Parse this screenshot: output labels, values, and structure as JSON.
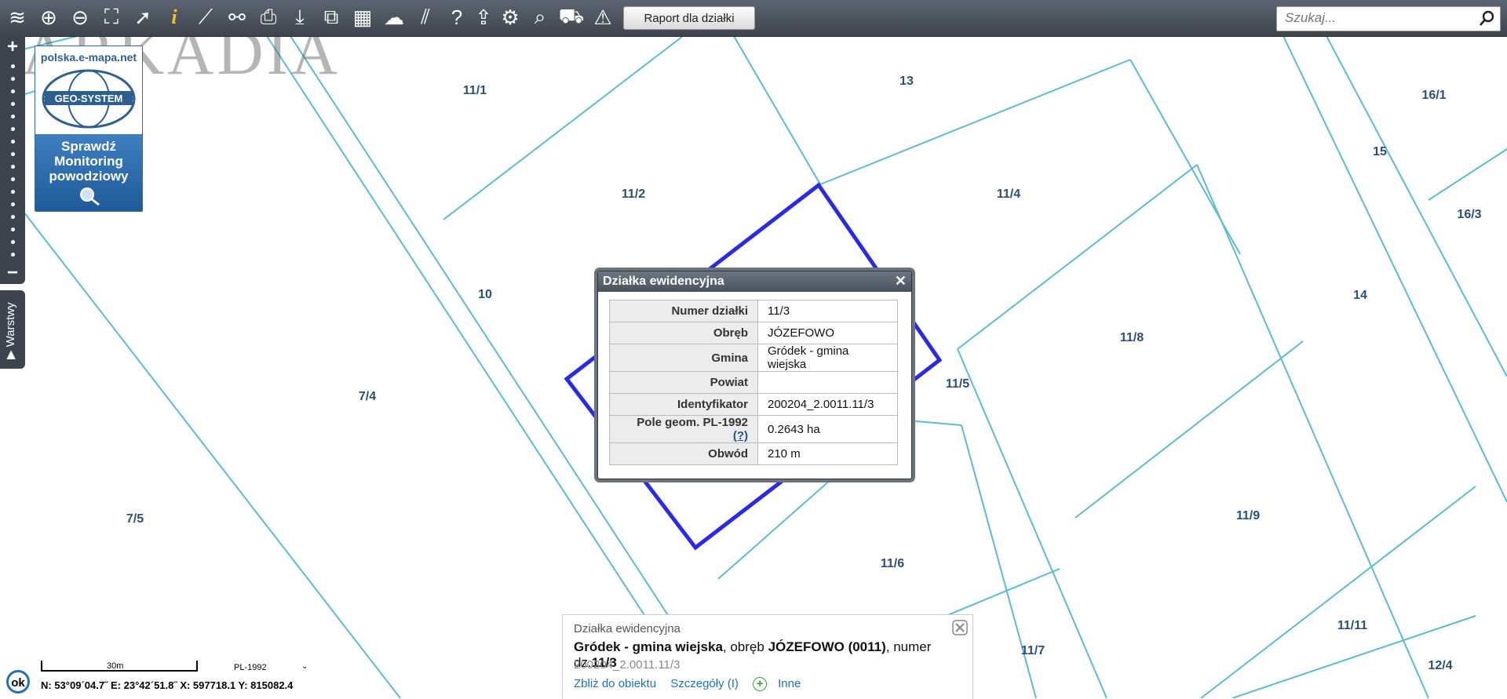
{
  "toolbar": {
    "report_button": "Raport dla działki",
    "search_placeholder": "Szukaj..."
  },
  "watermark": "ARKADIA",
  "promo": {
    "site": "polska.e-mapa.net",
    "logo": "GEO-SYSTEM",
    "text_line1": "Sprawdź",
    "text_line2": "Monitoring",
    "text_line3": "powodziowy"
  },
  "layers_tab": "Warstwy",
  "map": {
    "parcels": [
      "11/1",
      "13",
      "16/1",
      "15",
      "11/2",
      "11/4",
      "16/3",
      "10",
      "14",
      "11/8",
      "7/4",
      "11/5",
      "7/5",
      "11/9",
      "11/6",
      "11/11",
      "11/7",
      "12/4"
    ]
  },
  "popup": {
    "title": "Działka ewidencyjna",
    "rows": [
      {
        "key": "Numer działki",
        "value": "11/3"
      },
      {
        "key": "Obręb",
        "value": "JÓZEFOWO"
      },
      {
        "key": "Gmina",
        "value": "Gródek - gmina wiejska"
      },
      {
        "key": "Powiat",
        "value": ""
      },
      {
        "key": "Identyfikator",
        "value": "200204_2.0011.11/3"
      },
      {
        "key": "Pole geom. PL-1992",
        "key_suffix": "(?)",
        "value": "0.2643 ha"
      },
      {
        "key": "Obwód",
        "value": "210 m"
      }
    ]
  },
  "info": {
    "type": "Działka ewidencyjna",
    "gmina": "Gródek - gmina wiejska",
    "obreb_label": ", obręb ",
    "obreb": "JÓZEFOWO (0011)",
    "numer_label": ", numer dz.",
    "numer": "11/3",
    "identifier": "200204_2.0011.11/3",
    "link_zoom": "Zbliż do obiektu",
    "link_details": "Szczegóły (I)",
    "link_other": "Inne"
  },
  "footer": {
    "ok": "ok",
    "scale": "30m",
    "crs": "PL-1992",
    "coords": "N: 53°09´04.7˝ E: 23°42´51.8˝ X: 597718.1 Y: 815082.4"
  },
  "colors": {
    "parcel_line": "#5bbcd1",
    "selected": "#2a2ae6",
    "toolbar": "#4a525c"
  }
}
